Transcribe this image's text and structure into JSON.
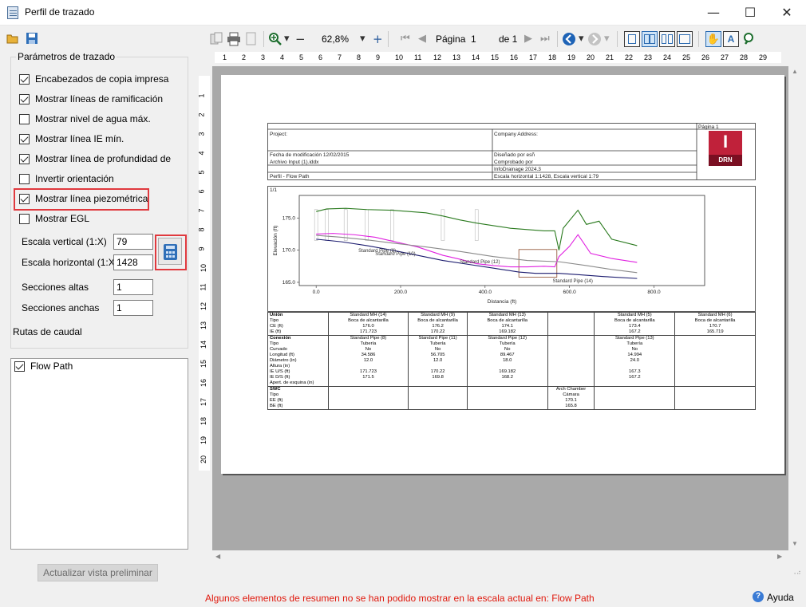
{
  "window": {
    "title": "Perfil de trazado",
    "minimize": "—",
    "maximize": "☐",
    "close": "✕"
  },
  "left": {
    "group_title": "Parámetros de trazado",
    "checkboxes": [
      {
        "label": "Encabezados de copia impresa",
        "checked": true
      },
      {
        "label": "Mostrar líneas de ramificación",
        "checked": true
      },
      {
        "label": "Mostrar nivel de agua máx.",
        "checked": false
      },
      {
        "label": "Mostrar línea IE mín.",
        "checked": true
      },
      {
        "label": "Mostrar línea de profundidad de",
        "checked": true
      },
      {
        "label": "Invertir orientación",
        "checked": false
      },
      {
        "label": "Mostrar línea piezométrica",
        "checked": true
      },
      {
        "label": "Mostrar EGL",
        "checked": false
      }
    ],
    "fields": {
      "vscale_label": "Escala vertical (1:X)",
      "vscale": "79",
      "hscale_label": "Escala horizontal (1:X)",
      "hscale": "1428",
      "tall_label": "Secciones altas",
      "tall": "1",
      "wide_label": "Secciones anchas",
      "wide": "1"
    },
    "routes_label": "Rutas de caudal",
    "routes": [
      {
        "label": "Flow Path",
        "checked": true
      }
    ],
    "update_button": "Actualizar vista preliminar"
  },
  "toolbar": {
    "zoom": "62,8%",
    "page_label": "Página",
    "page": "1",
    "of": "de 1"
  },
  "ruler": {
    "h": [
      "1",
      "2",
      "3",
      "4",
      "5",
      "6",
      "7",
      "8",
      "9",
      "10",
      "11",
      "12",
      "13",
      "14",
      "15",
      "16",
      "17",
      "18",
      "19",
      "20",
      "21",
      "22",
      "23",
      "24",
      "25",
      "26",
      "27",
      "28",
      "29"
    ],
    "v": [
      "1",
      "2",
      "3",
      "4",
      "5",
      "6",
      "7",
      "8",
      "9",
      "10",
      "11",
      "12",
      "13",
      "14",
      "15",
      "16",
      "17",
      "18",
      "19",
      "20"
    ]
  },
  "report": {
    "page_label": "Página 1",
    "project": "Project:",
    "company": "Company Address:",
    "modified": "Fecha de modificación 12/02/2015",
    "designed": "Diseñado por esñ",
    "input_file": "Archivo Input (1).iddx",
    "checked": "Comprobado por",
    "software": "InfoDrainage 2024.3",
    "profile": "Perfil - Flow Path",
    "scale": "Escala horizontal 1:1428, Escala vertical 1:79",
    "logo_letter": "I",
    "logo_text": "DRN"
  },
  "chart_data": {
    "type": "line",
    "title": "",
    "corner": "1/1",
    "xlabel": "Distancia (ft)",
    "ylabel": "Elevación (ft)",
    "xlim": [
      -40,
      920
    ],
    "ylim": [
      164.5,
      178.5
    ],
    "xticks": [
      0,
      200,
      400,
      600,
      800
    ],
    "xtick_labels": [
      "0.0",
      "200.0",
      "400.0",
      "600.0",
      "800.0"
    ],
    "yticks": [
      165,
      170,
      175
    ],
    "ytick_labels": [
      "165.0",
      "170.0",
      "175.0"
    ],
    "series": [
      {
        "color": "#2a7a1e",
        "x": [
          0,
          25,
          70,
          120,
          180,
          220,
          260,
          300,
          340,
          380,
          420,
          460,
          500,
          540,
          565,
          575,
          585,
          620,
          640,
          670,
          700,
          760
        ],
        "y": [
          176.0,
          176.4,
          176.5,
          176.3,
          176.2,
          176.0,
          175.8,
          175.3,
          174.7,
          174.2,
          173.8,
          173.4,
          173.2,
          173.0,
          173.0,
          170.0,
          173.4,
          176.2,
          174.0,
          174.5,
          171.7,
          170.7
        ]
      },
      {
        "color": "#e020e0",
        "x": [
          0,
          40,
          90,
          140,
          180,
          240,
          300,
          340,
          380,
          420,
          460,
          500,
          540,
          565,
          575,
          600,
          620,
          650,
          700,
          760
        ],
        "y": [
          172.5,
          172.6,
          172.4,
          172.0,
          171.4,
          170.5,
          169.2,
          168.6,
          167.9,
          167.6,
          167.4,
          167.4,
          167.5,
          167.4,
          169.0,
          170.6,
          172.4,
          169.5,
          168.7,
          168.1
        ]
      },
      {
        "color": "#8a8a8a",
        "x": [
          0,
          60,
          120,
          180,
          260,
          340,
          420,
          500,
          575,
          640,
          700,
          760
        ],
        "y": [
          172.3,
          172.0,
          171.6,
          171.1,
          170.5,
          169.8,
          169.0,
          168.4,
          168.2,
          167.6,
          167.0,
          166.5
        ]
      },
      {
        "color": "#1a1a6e",
        "x": [
          0,
          60,
          120,
          180,
          240,
          300,
          360,
          420,
          480,
          520,
          575,
          620,
          680,
          760
        ],
        "y": [
          171.7,
          171.3,
          170.7,
          170.0,
          169.2,
          168.4,
          167.8,
          167.2,
          166.6,
          166.4,
          166.4,
          166.2,
          165.9,
          165.6
        ]
      }
    ],
    "annotations": [
      {
        "text": "Standard Pipe (8)",
        "x": 100,
        "y": 169.7
      },
      {
        "text": "Standard Pipe (10)",
        "x": 140,
        "y": 169.2
      },
      {
        "text": "Standard Pipe (12)",
        "x": 340,
        "y": 168.0
      },
      {
        "text": "Standard Pipe (14)",
        "x": 560,
        "y": 165.0
      }
    ]
  },
  "table": {
    "rows": [
      [
        "Unión",
        "Standard MH (14)",
        "Standard MH (9)",
        "Standard MH (13)",
        "",
        "Standard MH (5)",
        "Standard MH (6)"
      ],
      [
        "Tipo",
        "Boca de alcantarilla",
        "Boca de alcantarilla",
        "Boca de alcantarilla",
        "",
        "Boca de alcantarilla",
        "Boca de alcantarilla"
      ],
      [
        "CE (ft)",
        "176.0",
        "176.2",
        "174.1",
        "",
        "173.4",
        "170.7"
      ],
      [
        "IE (ft)",
        "171.723",
        "170.22",
        "169.182",
        "",
        "167.2",
        "165.719"
      ],
      [
        "Conexión",
        "Standard Pipe (8)",
        "Standard Pipe (11)",
        "Standard Pipe (12)",
        "",
        "Standard Pipe (13)",
        ""
      ],
      [
        "Tipo",
        "Tubería",
        "Tubería",
        "Tubería",
        "",
        "Tubería",
        ""
      ],
      [
        "Curvado",
        "No",
        "No",
        "No",
        "",
        "No",
        ""
      ],
      [
        "Longitud (ft)",
        "34.586",
        "56.705",
        "89.467",
        "",
        "14.994",
        ""
      ],
      [
        "Diámetro (in)",
        "12.0",
        "12.0",
        "18.0",
        "",
        "24.0",
        ""
      ],
      [
        "Altura (in)",
        "",
        "",
        "",
        "",
        "",
        ""
      ],
      [
        "IE U/S (ft)",
        "171.723",
        "170.22",
        "169.182",
        "",
        "167.3",
        ""
      ],
      [
        "IE D/S (ft)",
        "171.5",
        "169.8",
        "168.2",
        "",
        "167.2",
        ""
      ],
      [
        "Apert. de esquina (in)",
        "",
        "",
        "",
        "",
        "",
        ""
      ],
      [
        "SWC",
        "",
        "",
        "",
        "Arch Chamber",
        "",
        ""
      ],
      [
        "Tipo",
        "",
        "",
        "",
        "Cámara",
        "",
        ""
      ],
      [
        "EE (ft)",
        "",
        "",
        "",
        "170.1",
        "",
        ""
      ],
      [
        "BE (ft)",
        "",
        "",
        "",
        "165.8",
        "",
        ""
      ]
    ]
  },
  "status": {
    "message": "Algunos elementos de resumen no se han podido mostrar en la escala actual en: Flow Path",
    "help": "Ayuda"
  }
}
